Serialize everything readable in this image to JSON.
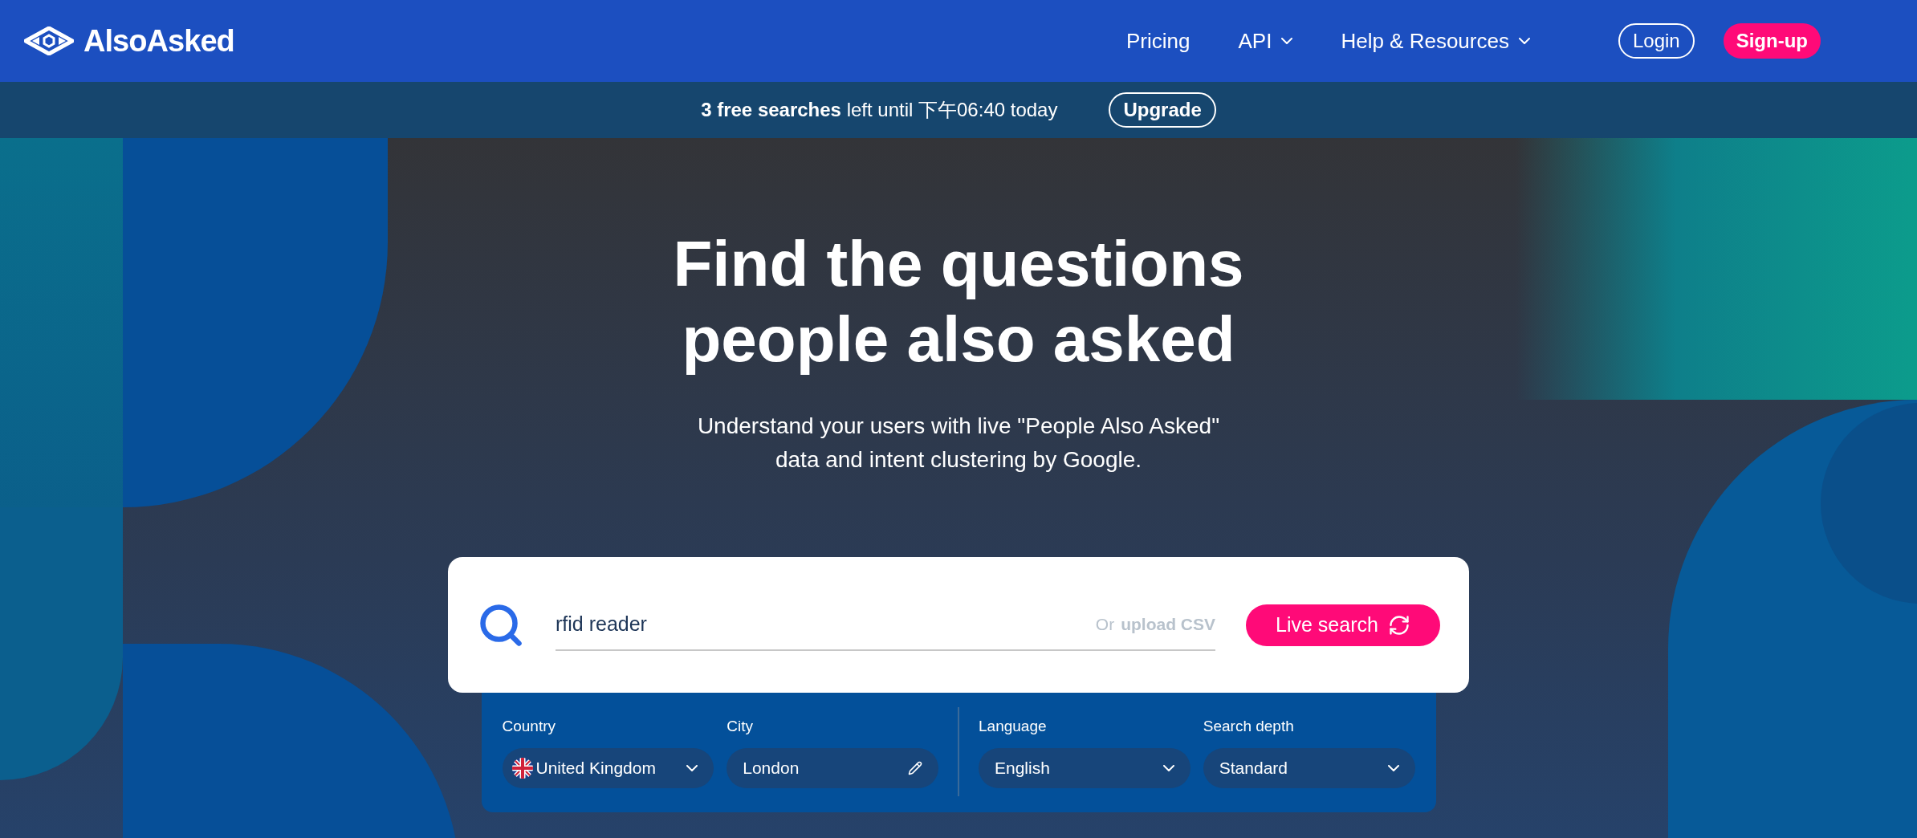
{
  "logo": {
    "text": "AlsoAsked"
  },
  "nav": [
    {
      "label": "Pricing",
      "has_menu": false
    },
    {
      "label": "API",
      "has_menu": true
    },
    {
      "label": "Help & Resources",
      "has_menu": true
    }
  ],
  "auth": {
    "login": "Login",
    "signup": "Sign-up"
  },
  "banner": {
    "text": "**3 free searches** left until 下午06:40 today",
    "button": "Upgrade"
  },
  "hero": {
    "title": "Find the questions people also asked",
    "subtitle": "Understand your users with live \"People Also Asked\" data and intent clustering by Google."
  },
  "search": {
    "value": "rfid reader",
    "or_text": "Or",
    "upload_link": "upload CSV",
    "button": "Live search"
  },
  "filters": [
    {
      "label": "Country",
      "value": "United Kingdom",
      "kind": "country"
    },
    {
      "label": "City",
      "value": "London",
      "kind": "text"
    },
    {
      "label": "Language",
      "value": "English",
      "kind": "select"
    },
    {
      "label": "Search depth",
      "value": "Standard",
      "kind": "select"
    }
  ]
}
